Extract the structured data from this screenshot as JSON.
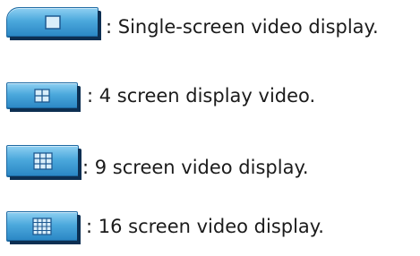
{
  "items": [
    {
      "icon": "single-screen-icon",
      "label": ": Single-screen video display."
    },
    {
      "icon": "four-screen-icon",
      "label": ": 4 screen display video."
    },
    {
      "icon": "nine-screen-icon",
      "label": ": 9 screen video display."
    },
    {
      "icon": "sixteen-screen-icon",
      "label": ": 16 screen video display."
    }
  ],
  "colors": {
    "button_light": "#8fd0f2",
    "button_dark": "#2a86c4",
    "button_shadow": "#0d2f52",
    "icon_stroke": "#1e5a92",
    "icon_fill": "#d9eefa"
  }
}
